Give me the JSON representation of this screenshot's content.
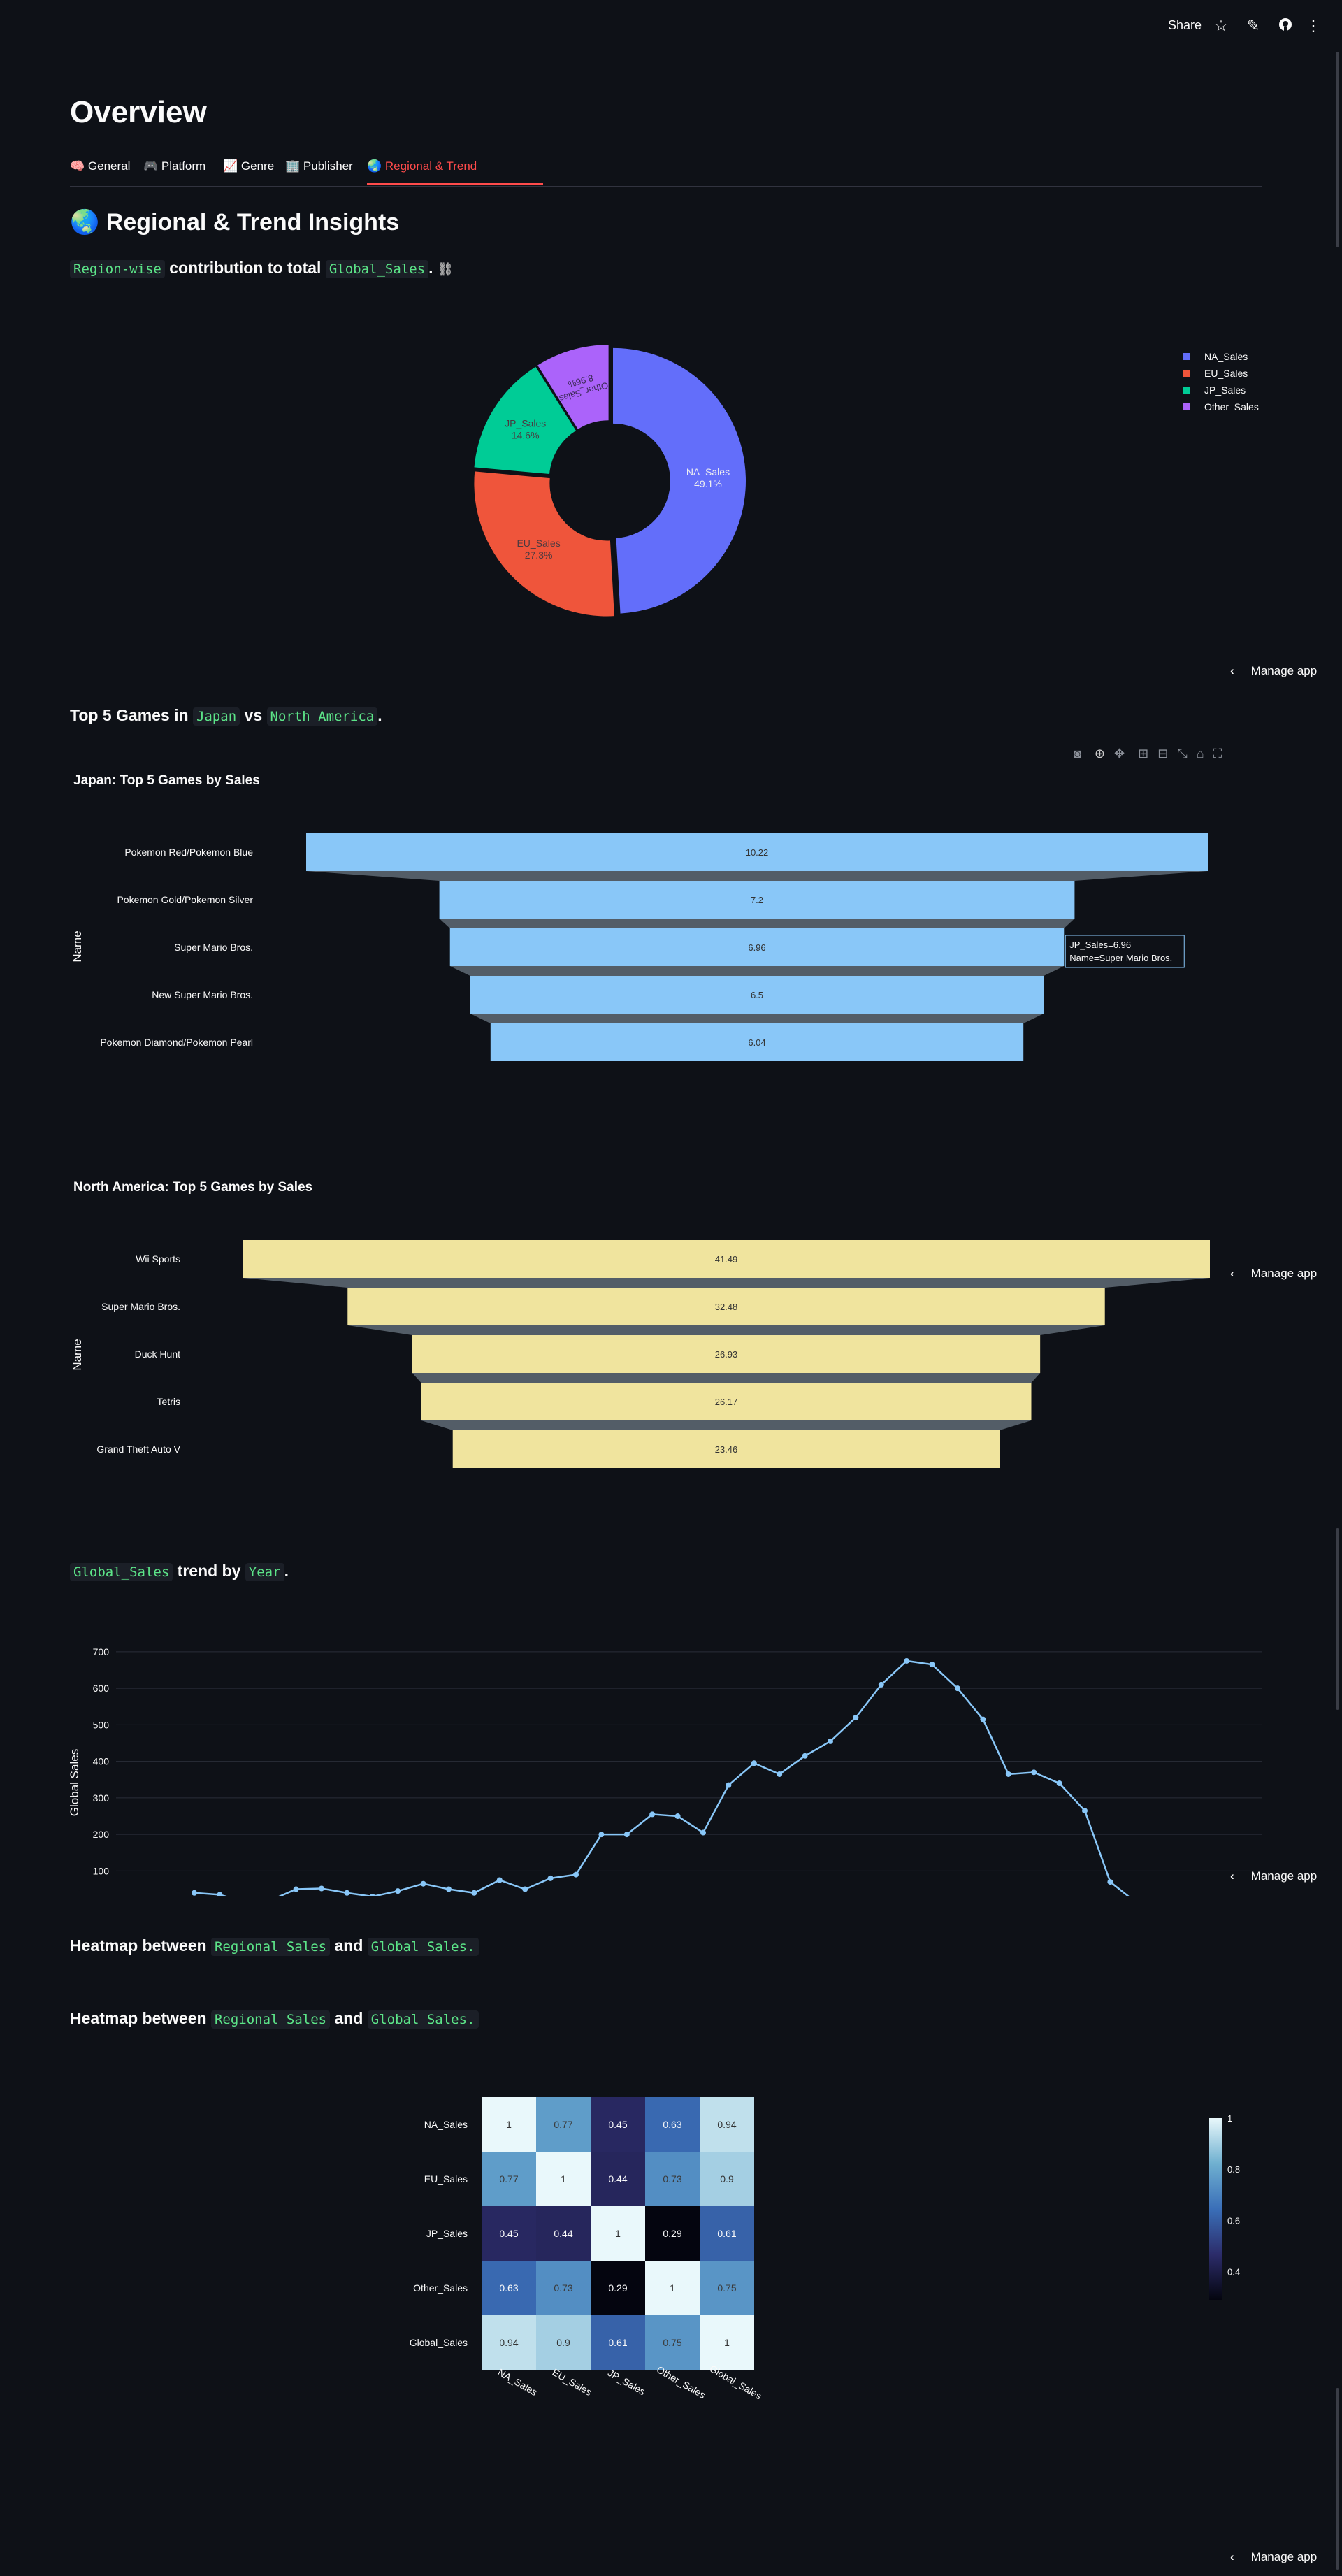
{
  "topbar": {
    "share": "Share"
  },
  "page": {
    "title": "Overview",
    "tabs": [
      {
        "label": "General",
        "icon": "🧠"
      },
      {
        "label": "Platform",
        "icon": "🎮"
      },
      {
        "label": "Genre",
        "icon": "📈"
      },
      {
        "label": "Publisher",
        "icon": "🏢"
      },
      {
        "label": "Regional & Trend",
        "icon": "🌏"
      }
    ],
    "section_title": "Regional & Trend Insights",
    "section_icon": "🌏"
  },
  "lines": {
    "region_code": "Region-wise",
    "region_text": "contribution to total",
    "region_code2": "Global_Sales",
    "region_end": ".",
    "top5_a": "Top 5 Games in",
    "top5_code1": "Japan",
    "top5_vs": "vs",
    "top5_code2": "North America",
    "top5_end": ".",
    "trend_code": "Global_Sales",
    "trend_text": "trend by",
    "trend_code2": "Year",
    "trend_end": ".",
    "heat_a": "Heatmap between",
    "heat_code1": "Regional Sales",
    "heat_and": "and",
    "heat_code2": "Global Sales."
  },
  "manage_app": "Manage app",
  "chart_data": [
    {
      "type": "pie",
      "labels": [
        "NA_Sales",
        "EU_Sales",
        "JP_Sales",
        "Other_Sales"
      ],
      "values": [
        49.1,
        27.3,
        14.6,
        8.96
      ],
      "value_labels": [
        "49.1%",
        "27.3%",
        "14.6%",
        "8.96%"
      ],
      "colors": [
        "#636efa",
        "#ef553b",
        "#00cc96",
        "#ab63fa"
      ],
      "legend": "right"
    },
    {
      "type": "bar",
      "subtype": "funnel",
      "title": "Japan: Top 5 Games by Sales",
      "ylabel": "Name",
      "categories": [
        "Pokemon Red/Pokemon Blue",
        "Pokemon Gold/Pokemon Silver",
        "Super Mario Bros.",
        "New Super Mario Bros.",
        "Pokemon Diamond/Pokemon Pearl"
      ],
      "values": [
        10.22,
        7.2,
        6.96,
        6.5,
        6.04
      ],
      "value_labels": [
        "10.22",
        "7.2",
        "6.96",
        "6.5",
        "6.04"
      ],
      "color": "#89c7f8",
      "tooltip": [
        "JP_Sales=6.96",
        "Name=Super Mario Bros."
      ]
    },
    {
      "type": "bar",
      "subtype": "funnel",
      "title": "North America: Top 5 Games by Sales",
      "ylabel": "Name",
      "categories": [
        "Wii Sports",
        "Super Mario Bros.",
        "Duck Hunt",
        "Tetris",
        "Grand Theft Auto V"
      ],
      "values": [
        41.49,
        32.48,
        26.93,
        26.17,
        23.46
      ],
      "value_labels": [
        "41.49",
        "32.48",
        "26.93",
        "26.17",
        "23.46"
      ],
      "color": "#f0e49e"
    },
    {
      "type": "line",
      "ylabel": "Global Sales",
      "ylim": [
        30,
        740
      ],
      "yticks": [
        100,
        200,
        300,
        400,
        500,
        600,
        700
      ],
      "values": [
        40,
        35,
        15,
        20,
        50,
        52,
        40,
        30,
        45,
        65,
        50,
        40,
        75,
        50,
        80,
        90,
        200,
        200,
        255,
        250,
        205,
        335,
        395,
        365,
        415,
        455,
        520,
        610,
        675,
        665,
        600,
        515,
        365,
        370,
        340,
        265,
        70,
        15
      ],
      "color": "#89c7f8",
      "grid": true
    },
    {
      "type": "heatmap",
      "rows": [
        "NA_Sales",
        "EU_Sales",
        "JP_Sales",
        "Other_Sales",
        "Global_Sales"
      ],
      "cols": [
        "NA_Sales",
        "EU_Sales",
        "JP_Sales",
        "Other_Sales",
        "Global_Sales"
      ],
      "values": [
        [
          1,
          0.77,
          0.45,
          0.63,
          0.94
        ],
        [
          0.77,
          1,
          0.44,
          0.73,
          0.9
        ],
        [
          0.45,
          0.44,
          1,
          0.29,
          0.61
        ],
        [
          0.63,
          0.73,
          0.29,
          1,
          0.75
        ],
        [
          0.94,
          0.9,
          0.61,
          0.75,
          1
        ]
      ],
      "colorscale": [
        "#04050f",
        "#2c2c6a",
        "#3a6fb8",
        "#6fb0d0",
        "#e9f8fb"
      ],
      "colorbar_ticks": [
        0.4,
        0.6,
        0.8,
        1
      ]
    }
  ]
}
